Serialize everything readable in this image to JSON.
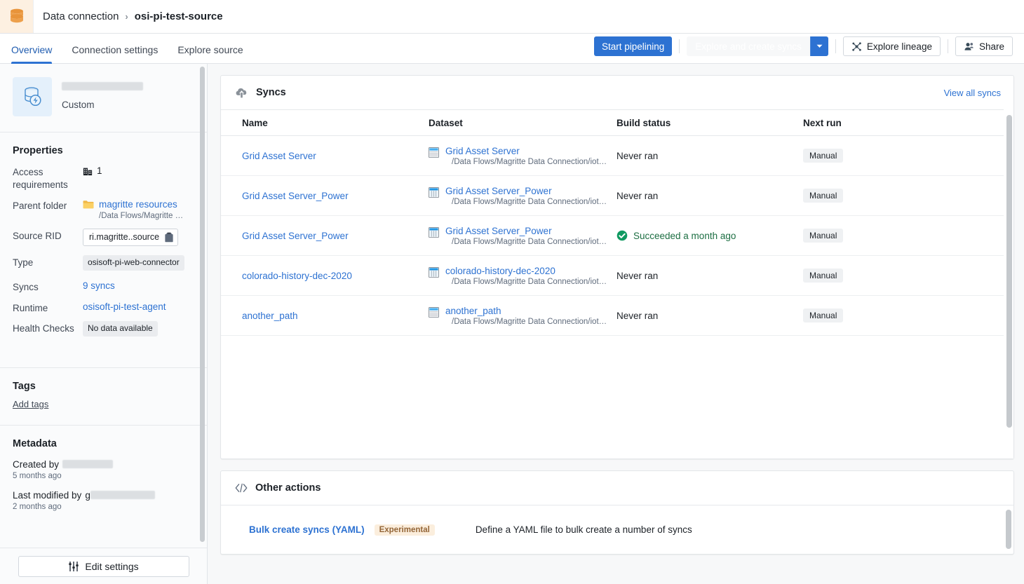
{
  "topbar": {
    "logo_icon": "database-icon",
    "breadcrumb": {
      "parent": "Data connection",
      "separator": "›",
      "current": "osi-pi-test-source"
    }
  },
  "tabs": [
    {
      "label": "Overview",
      "active": true
    },
    {
      "label": "Connection settings",
      "active": false
    },
    {
      "label": "Explore source",
      "active": false
    }
  ],
  "actions": {
    "start_pipelining": "Start pipelining",
    "explore_create_syncs": "Explore and create syncs",
    "dropdown_caret_icon": "chevron-down-icon",
    "explore_lineage": "Explore lineage",
    "explore_lineage_icon": "lineage-icon",
    "share": "Share",
    "share_icon": "person-share-icon"
  },
  "sidebar": {
    "connection": {
      "icon": "database-lightning-icon",
      "name_redacted": true,
      "subtitle": "Custom"
    },
    "properties": {
      "title": "Properties",
      "rows": [
        {
          "label": "Access requirements",
          "icon": "organization-icon",
          "value": "1"
        },
        {
          "label": "Parent folder",
          "icon": "folder-icon",
          "value": "magritte resources",
          "sub": "/Data Flows/Magritte …"
        },
        {
          "label": "Source RID",
          "value": "ri.magritte..source",
          "copy_icon": "clipboard-icon"
        },
        {
          "label": "Type",
          "value": "osisoft-pi-web-connector"
        },
        {
          "label": "Syncs",
          "value": "9 syncs"
        },
        {
          "label": "Runtime",
          "value": "osisoft-pi-test-agent"
        },
        {
          "label": "Health Checks",
          "value": "No data available"
        }
      ]
    },
    "tags": {
      "title": "Tags",
      "add_label": "Add tags"
    },
    "metadata": {
      "title": "Metadata",
      "created_by_label": "Created by",
      "created_ago": "5 months ago",
      "modified_by_label": "Last modified by",
      "modified_by_prefix": "g",
      "modified_ago": "2 months ago"
    },
    "footer": {
      "edit_settings": "Edit settings",
      "edit_icon": "sliders-icon"
    }
  },
  "main": {
    "syncs_card": {
      "icon": "cloud-upload-icon",
      "title": "Syncs",
      "view_all": "View all syncs",
      "columns": [
        "Name",
        "Dataset",
        "Build status",
        "Next run"
      ],
      "rows": [
        {
          "name": "Grid Asset Server",
          "dataset": "Grid Asset Server",
          "dataset_icon": "table-dataset-icon",
          "dataset_path": "/Data Flows/Magritte Data Connection/iot…",
          "status": "Never ran",
          "status_type": "never",
          "next_run": "Manual"
        },
        {
          "name": "Grid Asset Server_Power",
          "dataset": "Grid Asset Server_Power",
          "dataset_icon": "column-dataset-icon",
          "dataset_path": "/Data Flows/Magritte Data Connection/iot…",
          "status": "Never ran",
          "status_type": "never",
          "next_run": "Manual"
        },
        {
          "name": "Grid Asset Server_Power",
          "dataset": "Grid Asset Server_Power",
          "dataset_icon": "column-dataset-icon",
          "dataset_path": "/Data Flows/Magritte Data Connection/iot…",
          "status": "Succeeded a month ago",
          "status_type": "success",
          "status_icon": "check-circle-icon",
          "next_run": "Manual"
        },
        {
          "name": "colorado-history-dec-2020",
          "dataset": "colorado-history-dec-2020",
          "dataset_icon": "column-dataset-icon",
          "dataset_path": "/Data Flows/Magritte Data Connection/iot…",
          "status": "Never ran",
          "status_type": "never",
          "next_run": "Manual"
        },
        {
          "name": "another_path",
          "dataset": "another_path",
          "dataset_icon": "table-dataset-icon",
          "dataset_path": "/Data Flows/Magritte Data Connection/iot…",
          "status": "Never ran",
          "status_type": "never",
          "next_run": "Manual"
        }
      ]
    },
    "other_actions_card": {
      "icon": "code-icon",
      "title": "Other actions",
      "link": "Bulk create syncs (YAML)",
      "badge": "Experimental",
      "description": "Define a YAML file to bulk create a number of syncs"
    }
  },
  "colors": {
    "accent_blue": "#2d72d2",
    "link_blue": "#2d72d2",
    "success_green": "#1c6e42",
    "logo_orange": "#e8943a",
    "badge_amber_bg": "#fbeedd",
    "badge_amber_text": "#946638"
  }
}
